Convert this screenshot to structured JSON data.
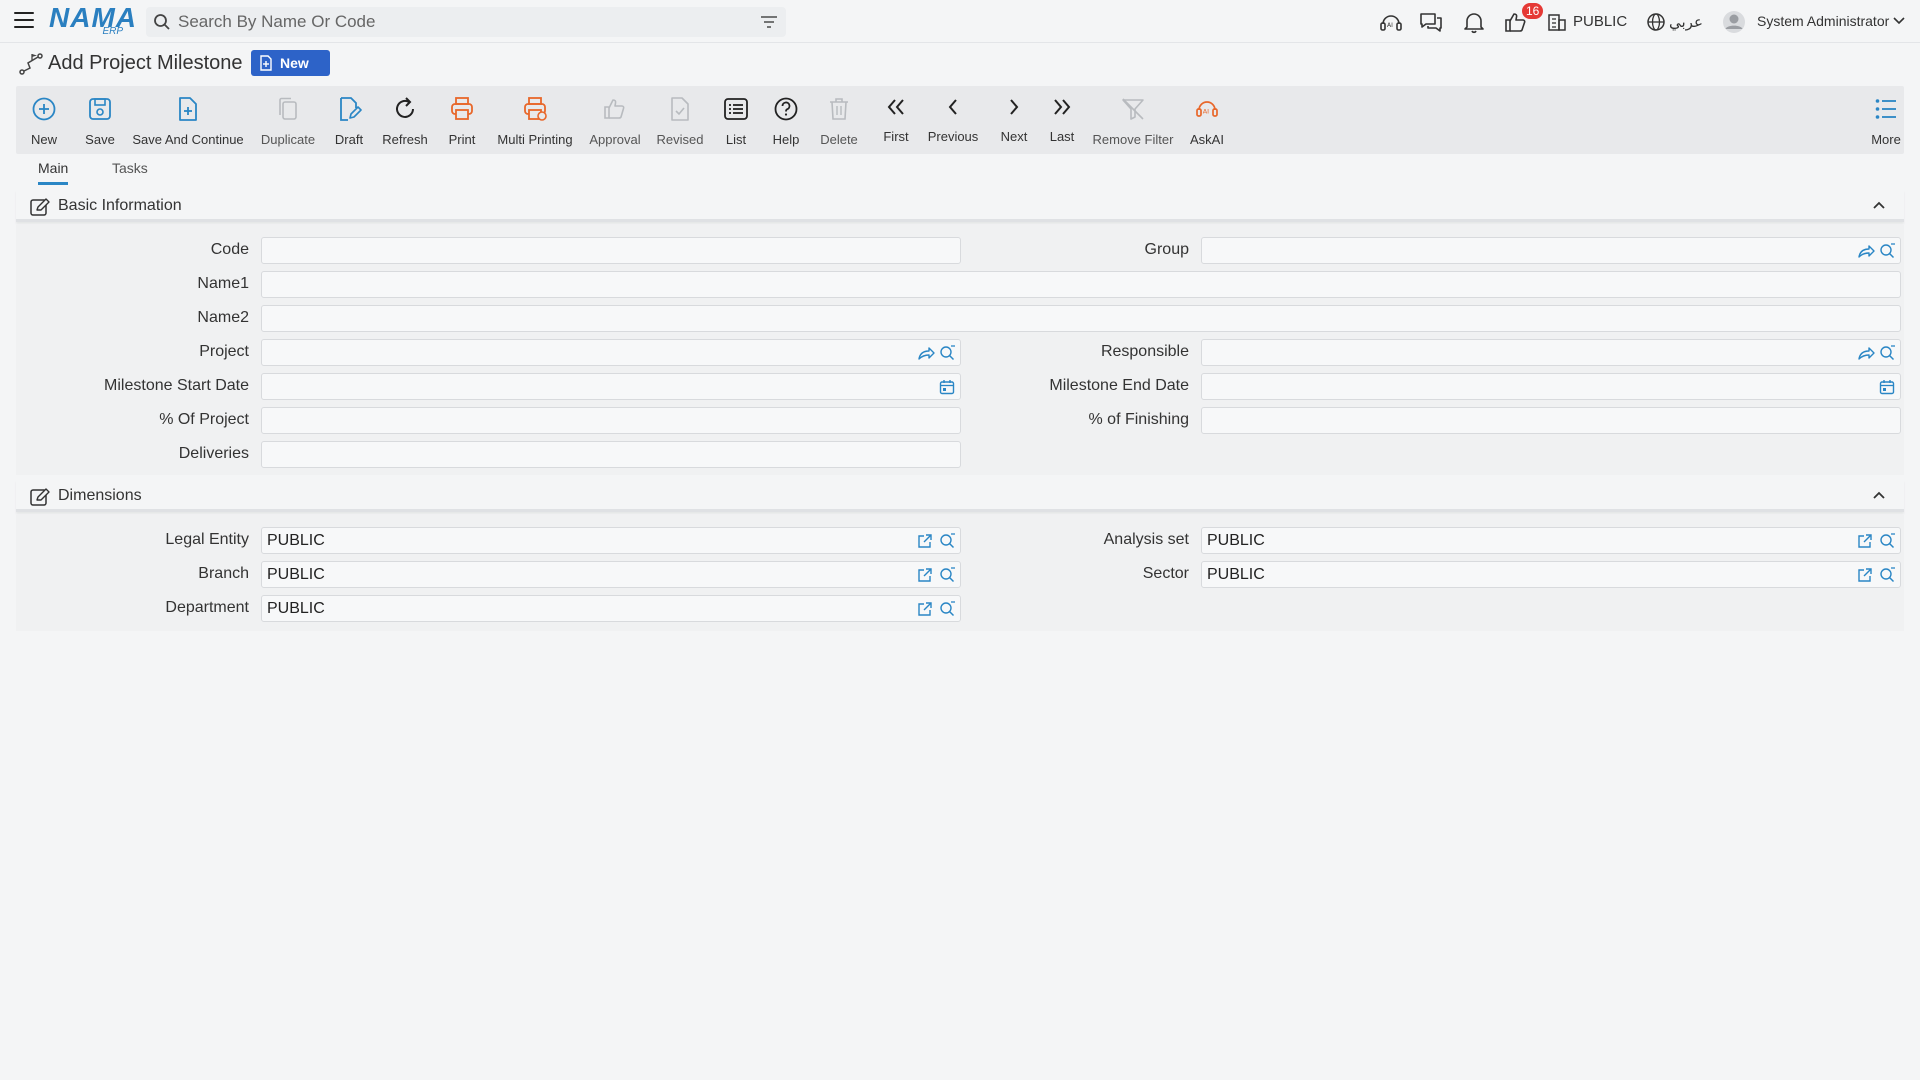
{
  "header": {
    "logo_main": "NAMA",
    "logo_sub": "ERP",
    "search_placeholder": "Search By Name Or Code",
    "notification_count": "16",
    "entity": "PUBLIC",
    "language": "عربي",
    "user": "System Administrator"
  },
  "page": {
    "title": "Add Project Milestone",
    "status": "New"
  },
  "toolbar": {
    "new": "New",
    "save": "Save",
    "save_continue": "Save And Continue",
    "duplicate": "Duplicate",
    "draft": "Draft",
    "refresh": "Refresh",
    "print": "Print",
    "multi_printing": "Multi Printing",
    "approval": "Approval",
    "revised": "Revised",
    "list": "List",
    "help": "Help",
    "delete": "Delete",
    "first": "First",
    "previous": "Previous",
    "next": "Next",
    "last": "Last",
    "remove_filter": "Remove Filter",
    "askai": "AskAI",
    "more": "More"
  },
  "tabs": [
    "Main",
    "Tasks"
  ],
  "basic_info": {
    "title": "Basic Information",
    "labels": {
      "code": "Code",
      "group": "Group",
      "name1": "Name1",
      "name2": "Name2",
      "project": "Project",
      "responsible": "Responsible",
      "start_date": "Milestone Start Date",
      "end_date": "Milestone End Date",
      "pct_project": "% Of Project",
      "pct_finishing": "% of Finishing",
      "deliveries": "Deliveries"
    }
  },
  "dimensions": {
    "title": "Dimensions",
    "labels": {
      "legal_entity": "Legal Entity",
      "analysis_set": "Analysis set",
      "branch": "Branch",
      "sector": "Sector",
      "department": "Department"
    },
    "values": {
      "legal_entity": "PUBLIC",
      "analysis_set": "PUBLIC",
      "branch": "PUBLIC",
      "sector": "PUBLIC",
      "department": "PUBLIC"
    }
  },
  "colors": {
    "accent": "#2a86c5",
    "orange": "#e8672a",
    "badge_red": "#e53935",
    "status_blue": "#2d63c8"
  }
}
